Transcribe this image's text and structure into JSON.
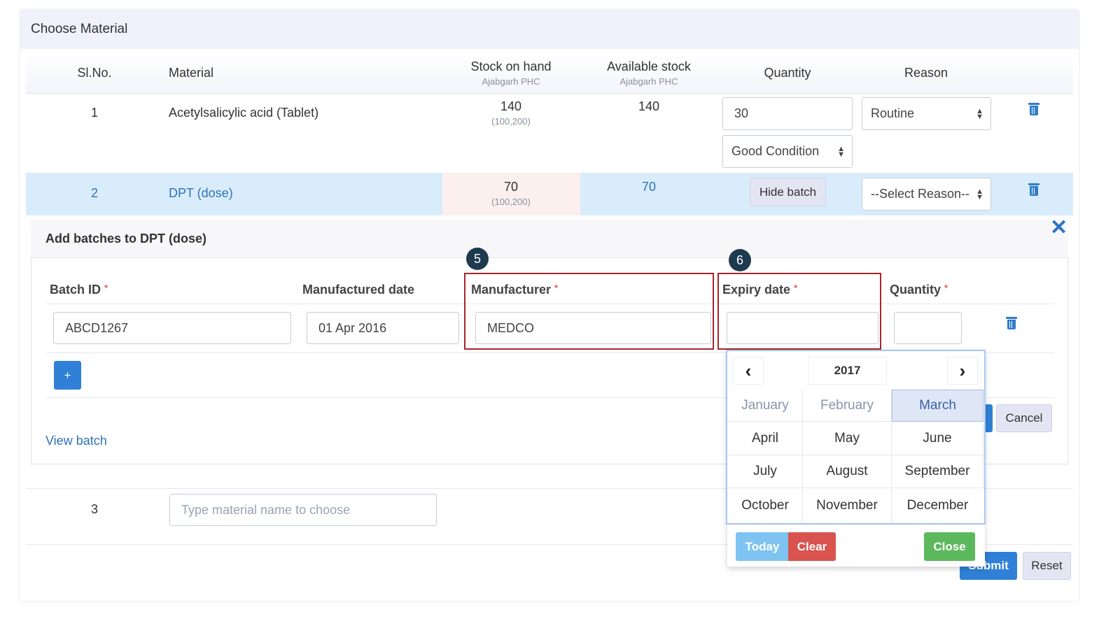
{
  "panel": {
    "title": "Choose Material"
  },
  "table": {
    "headers": {
      "slno": "Sl.No.",
      "material": "Material",
      "stock_on_hand": "Stock on hand",
      "stock_on_hand_sub": "Ajabgarh PHC",
      "available_stock": "Available stock",
      "available_stock_sub": "Ajabgarh PHC",
      "quantity": "Quantity",
      "reason": "Reason"
    },
    "rows": [
      {
        "slno": "1",
        "material": "Acetylsalicylic acid (Tablet)",
        "stock_on_hand": "140",
        "stock_range": "(100,200)",
        "available": "140",
        "quantity": "30",
        "reason": "Routine",
        "condition": "Good Condition"
      },
      {
        "slno": "2",
        "material": "DPT (dose)",
        "stock_on_hand": "70",
        "stock_range": "(100,200)",
        "available": "70",
        "hide_batch_label": "Hide batch",
        "reason": "--Select Reason--"
      },
      {
        "slno": "3",
        "material_placeholder": "Type material name to choose"
      }
    ]
  },
  "batch_panel": {
    "title": "Add batches to DPT (dose)",
    "close_symbol": "✕",
    "headers": {
      "batch_id": "Batch ID",
      "manufactured_date": "Manufactured date",
      "manufacturer": "Manufacturer",
      "expiry_date": "Expiry date",
      "quantity": "Quantity",
      "required_mark": "*"
    },
    "row": {
      "batch_id": "ABCD1267",
      "manufactured_date": "01 Apr 2016",
      "manufacturer": "MEDCO",
      "expiry_date": "",
      "quantity": ""
    },
    "add_button": "+",
    "view_batch": "View batch",
    "cancel_button": "Cancel"
  },
  "markers": {
    "manufacturer": "5",
    "expiry": "6"
  },
  "datepicker": {
    "year": "2017",
    "prev_symbol": "‹",
    "next_symbol": "›",
    "months": [
      "January",
      "February",
      "March",
      "April",
      "May",
      "June",
      "July",
      "August",
      "September",
      "October",
      "November",
      "December"
    ],
    "selected_month": "March",
    "today_button": "Today",
    "clear_button": "Clear",
    "close_button": "Close"
  },
  "footer": {
    "submit_button": "Submit",
    "reset_button": "Reset"
  },
  "colors": {
    "accent": "#2f80d6",
    "highlight_box": "#a8252b",
    "selected_row": "#d9ecfb",
    "danger": "#d9534f",
    "success": "#5cb85c"
  }
}
